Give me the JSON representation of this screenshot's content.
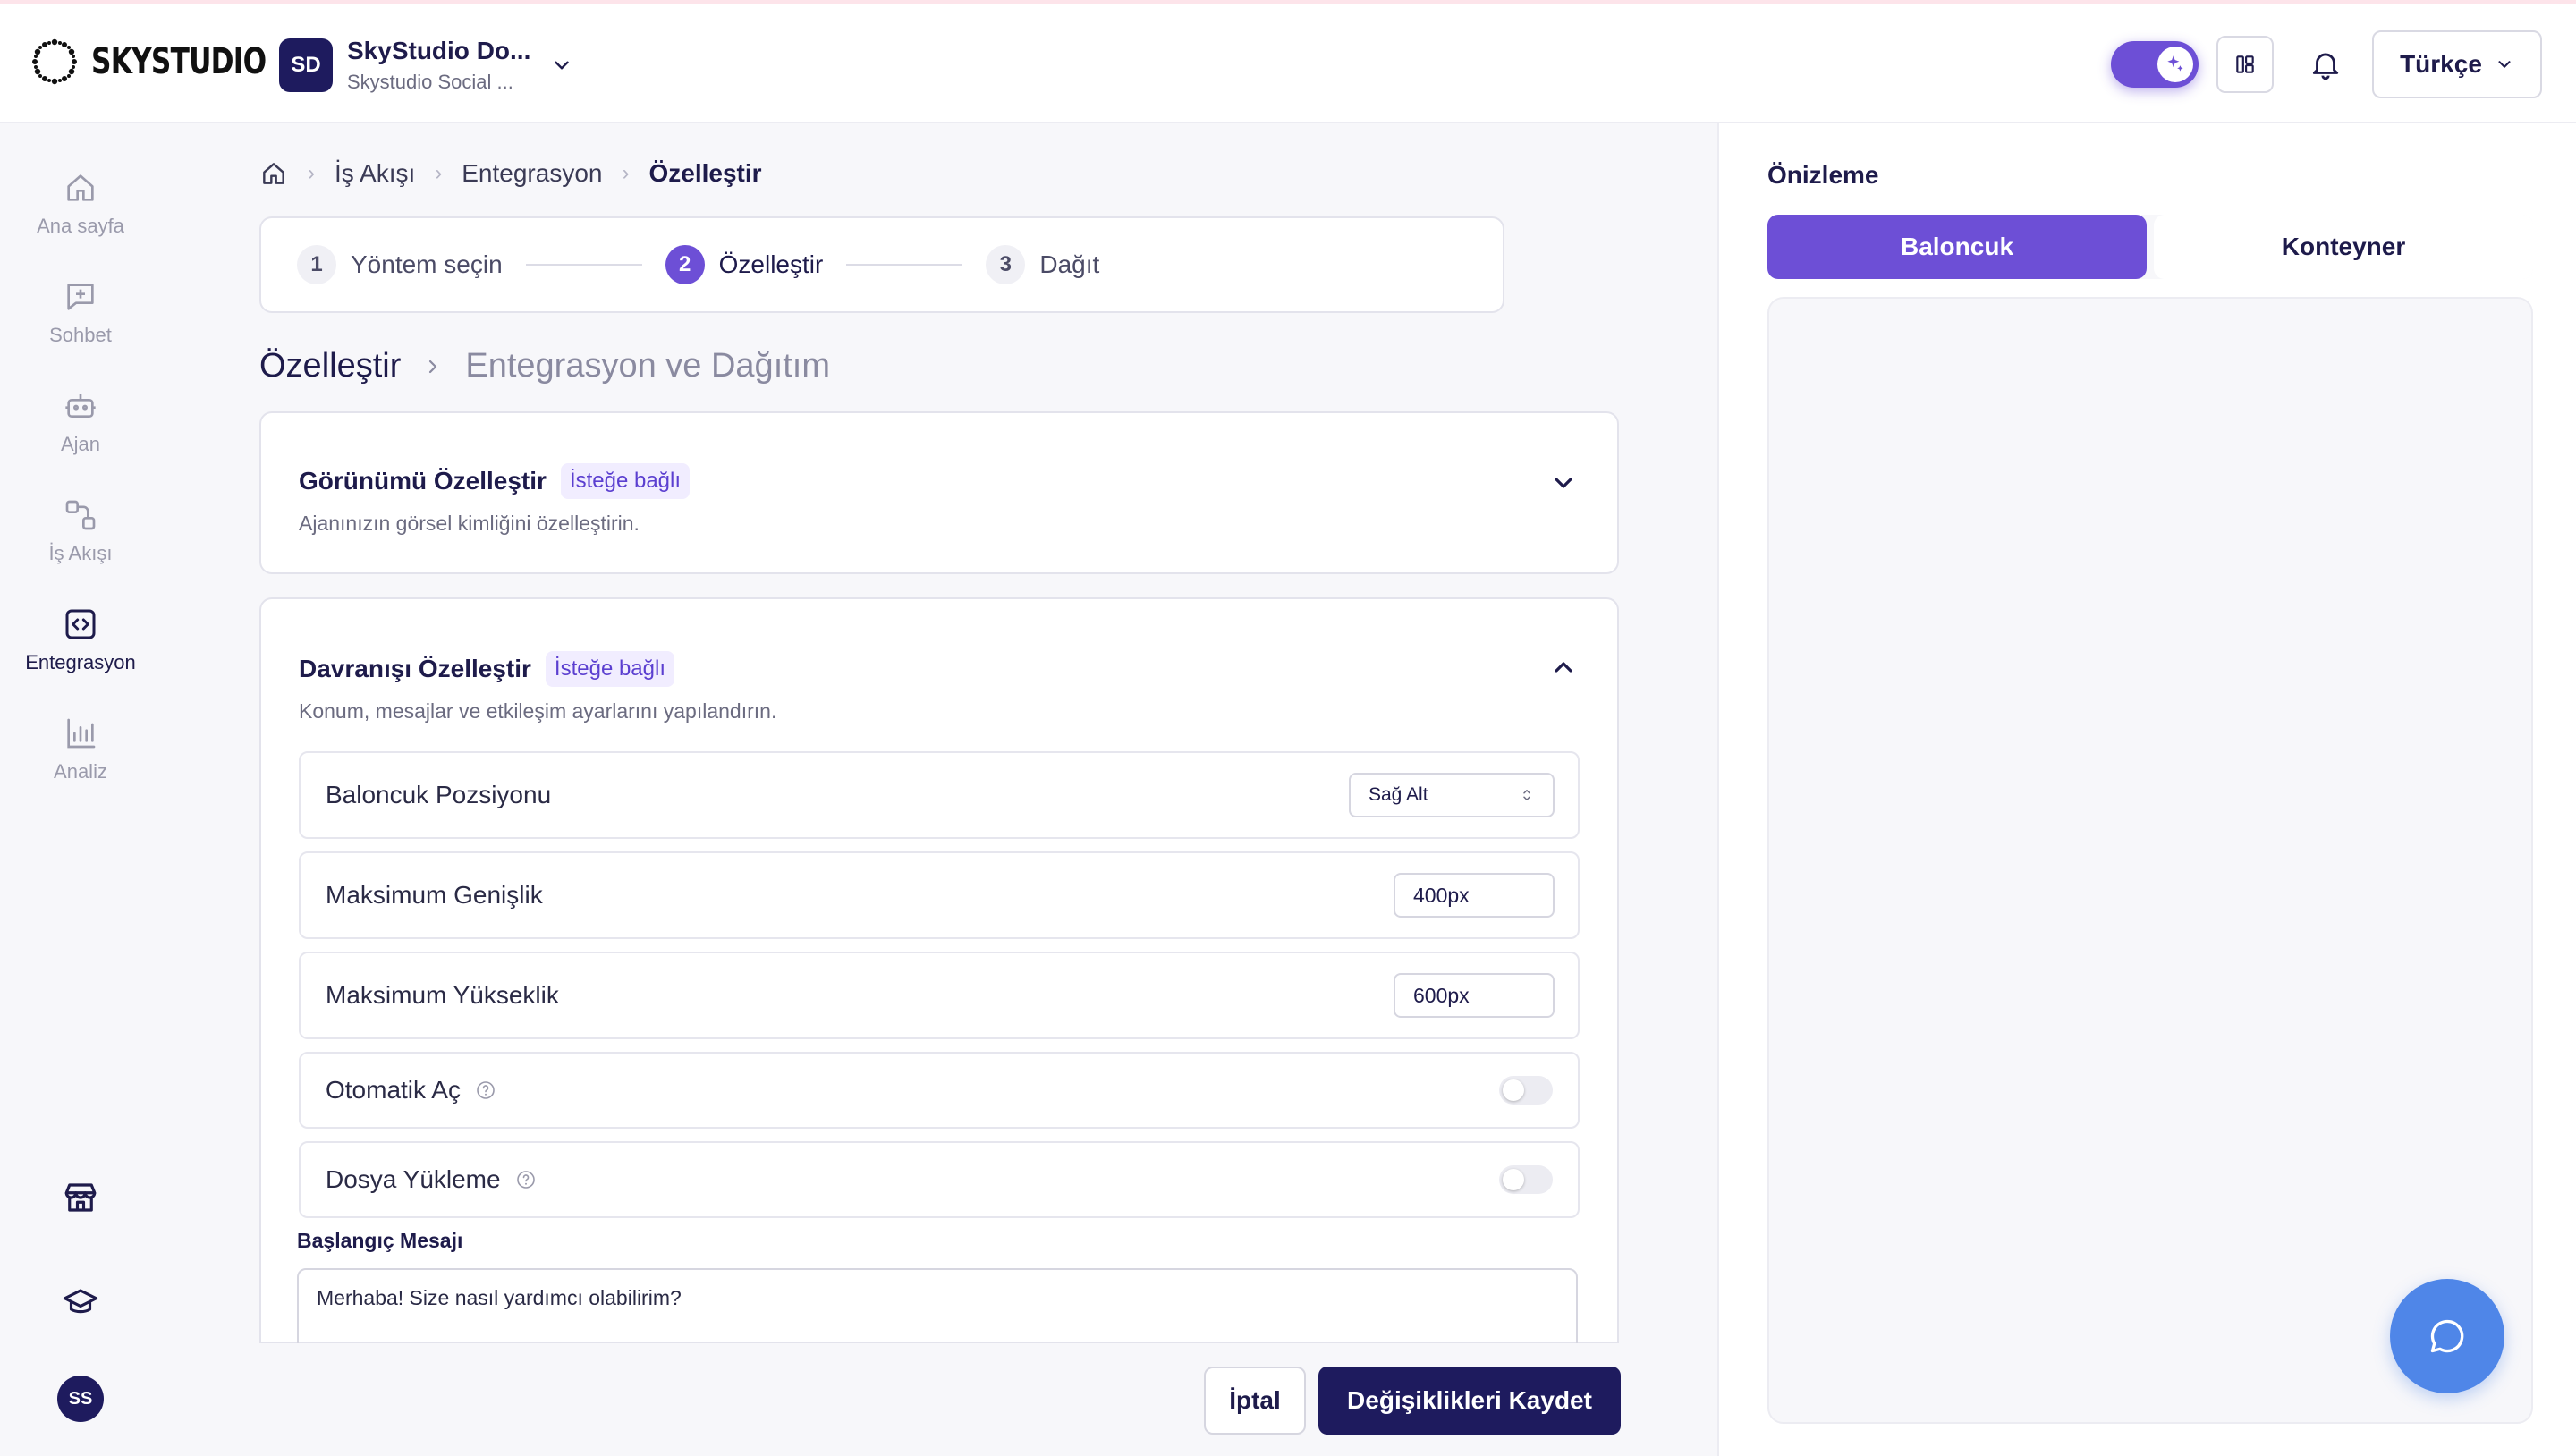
{
  "brand": {
    "name": "SKYSTUDIO"
  },
  "workspace": {
    "initials": "SD",
    "name": "SkyStudio Do...",
    "subtitle": "Skystudio Social ..."
  },
  "header": {
    "language": "Türkçe"
  },
  "sidebar": {
    "items": [
      {
        "label": "Ana sayfa",
        "icon": "home-icon"
      },
      {
        "label": "Sohbet",
        "icon": "chat-plus-icon"
      },
      {
        "label": "Ajan",
        "icon": "robot-icon"
      },
      {
        "label": "İş Akışı",
        "icon": "workflow-icon"
      },
      {
        "label": "Entegrasyon",
        "icon": "code-icon",
        "active": true
      },
      {
        "label": "Analiz",
        "icon": "bar-chart-icon"
      }
    ],
    "user_initials": "SS"
  },
  "breadcrumb": {
    "items": [
      "İş Akışı",
      "Entegrasyon",
      "Özelleştir"
    ]
  },
  "stepper": {
    "steps": [
      {
        "num": "1",
        "label": "Yöntem seçin"
      },
      {
        "num": "2",
        "label": "Özelleştir",
        "active": true
      },
      {
        "num": "3",
        "label": "Dağıt"
      }
    ]
  },
  "subtitle": {
    "current": "Özelleştir",
    "next": "Entegrasyon ve Dağıtım"
  },
  "appearance": {
    "title": "Görünümü Özelleştir",
    "badge": "İsteğe bağlı",
    "description": "Ajanınızın görsel kimliğini özelleştirin."
  },
  "behavior": {
    "title": "Davranışı Özelleştir",
    "badge": "İsteğe bağlı",
    "description": "Konum, mesajlar ve etkileşim ayarlarını yapılandırın.",
    "position_label": "Baloncuk Pozsiyonu",
    "position_value": "Sağ Alt",
    "max_width_label": "Maksimum Genişlik",
    "max_width_value": "400px",
    "max_height_label": "Maksimum Yükseklik",
    "max_height_value": "600px",
    "auto_open_label": "Otomatik Aç",
    "auto_open_on": false,
    "file_upload_label": "Dosya Yükleme",
    "file_upload_on": false,
    "start_message_label": "Başlangıç Mesajı",
    "start_message_value": "Merhaba! Size nasıl yardımcı olabilirim?"
  },
  "actions": {
    "cancel": "İptal",
    "save": "Değişiklikleri Kaydet"
  },
  "preview": {
    "title": "Önizleme",
    "tabs": [
      "Baloncuk",
      "Konteyner"
    ],
    "active_tab": "Baloncuk"
  },
  "colors": {
    "primary": "#6d4fd6",
    "navy": "#1e1b5e",
    "bubble": "#4f86e8"
  }
}
